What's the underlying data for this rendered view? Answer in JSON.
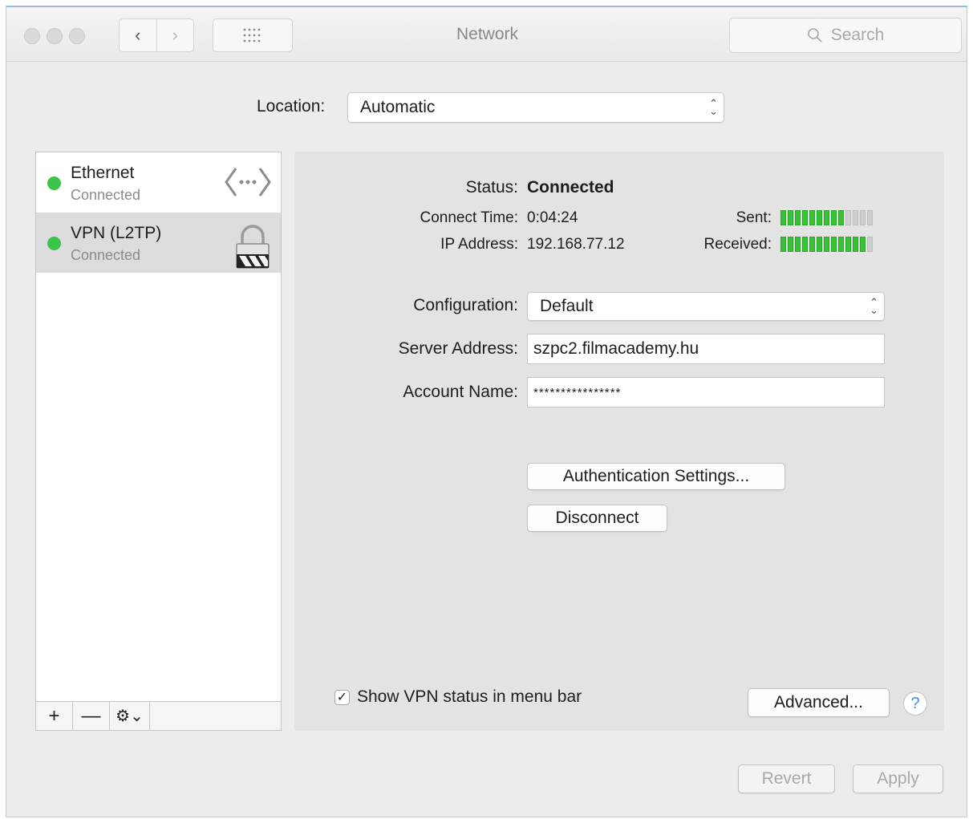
{
  "window": {
    "title": "Network",
    "search_placeholder": "Search"
  },
  "location": {
    "label": "Location:",
    "value": "Automatic"
  },
  "services": [
    {
      "name": "Ethernet",
      "status": "Connected",
      "icon": "ethernet-icon"
    },
    {
      "name": "VPN (L2TP)",
      "status": "Connected",
      "icon": "vpn-lock-icon"
    }
  ],
  "list_controls": {
    "add": "+",
    "remove": "—",
    "gear": "⚙⌄"
  },
  "detail": {
    "status_label": "Status:",
    "status_value": "Connected",
    "connect_time_label": "Connect Time:",
    "connect_time_value": "0:04:24",
    "ip_label": "IP Address:",
    "ip_value": "192.168.77.12",
    "sent_label": "Sent:",
    "sent_level": 0.7,
    "received_label": "Received:",
    "received_level": 0.9,
    "configuration_label": "Configuration:",
    "configuration_value": "Default",
    "server_label": "Server Address:",
    "server_value": "szpc2.filmacademy.hu",
    "account_label": "Account Name:",
    "account_value": "****************",
    "auth_button": "Authentication Settings...",
    "disconnect_button": "Disconnect",
    "show_vpn_status": "Show VPN status in menu bar",
    "show_vpn_checked": true,
    "advanced_button": "Advanced...",
    "help_glyph": "?"
  },
  "footer": {
    "revert": "Revert",
    "apply": "Apply"
  },
  "colors": {
    "status_green": "#3cc44a",
    "meter_green": "#39c238",
    "help_blue": "#3b8ff0"
  }
}
